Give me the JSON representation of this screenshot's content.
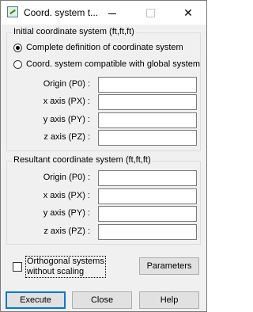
{
  "window": {
    "title": "Coord. system t...",
    "minimize_glyph": "—",
    "maximize_glyph": "☐",
    "close_glyph": "✕"
  },
  "initial_group": {
    "title": "Initial coordinate system (ft,ft,ft)",
    "options": [
      {
        "label": "Complete definition of coordinate system",
        "checked": true
      },
      {
        "label": "Coord. system compatible with global system",
        "checked": false
      }
    ],
    "fields": [
      {
        "label": "Origin (P0) :",
        "value": ""
      },
      {
        "label": "x axis (PX) :",
        "value": ""
      },
      {
        "label": "y axis (PY) :",
        "value": ""
      },
      {
        "label": "z axis (PZ) :",
        "value": ""
      }
    ]
  },
  "resultant_group": {
    "title": "Resultant coordinate system (ft,ft,ft)",
    "fields": [
      {
        "label": "Origin (P0) :",
        "value": ""
      },
      {
        "label": "x axis (PX) :",
        "value": ""
      },
      {
        "label": "y axis (PY) :",
        "value": ""
      },
      {
        "label": "z axis (PZ) :",
        "value": ""
      }
    ]
  },
  "options": {
    "orthogonal_label": "Orthogonal systems\nwithout scaling",
    "orthogonal_checked": false,
    "parameters_label": "Parameters"
  },
  "buttons": {
    "execute": "Execute",
    "close": "Close",
    "help": "Help"
  }
}
